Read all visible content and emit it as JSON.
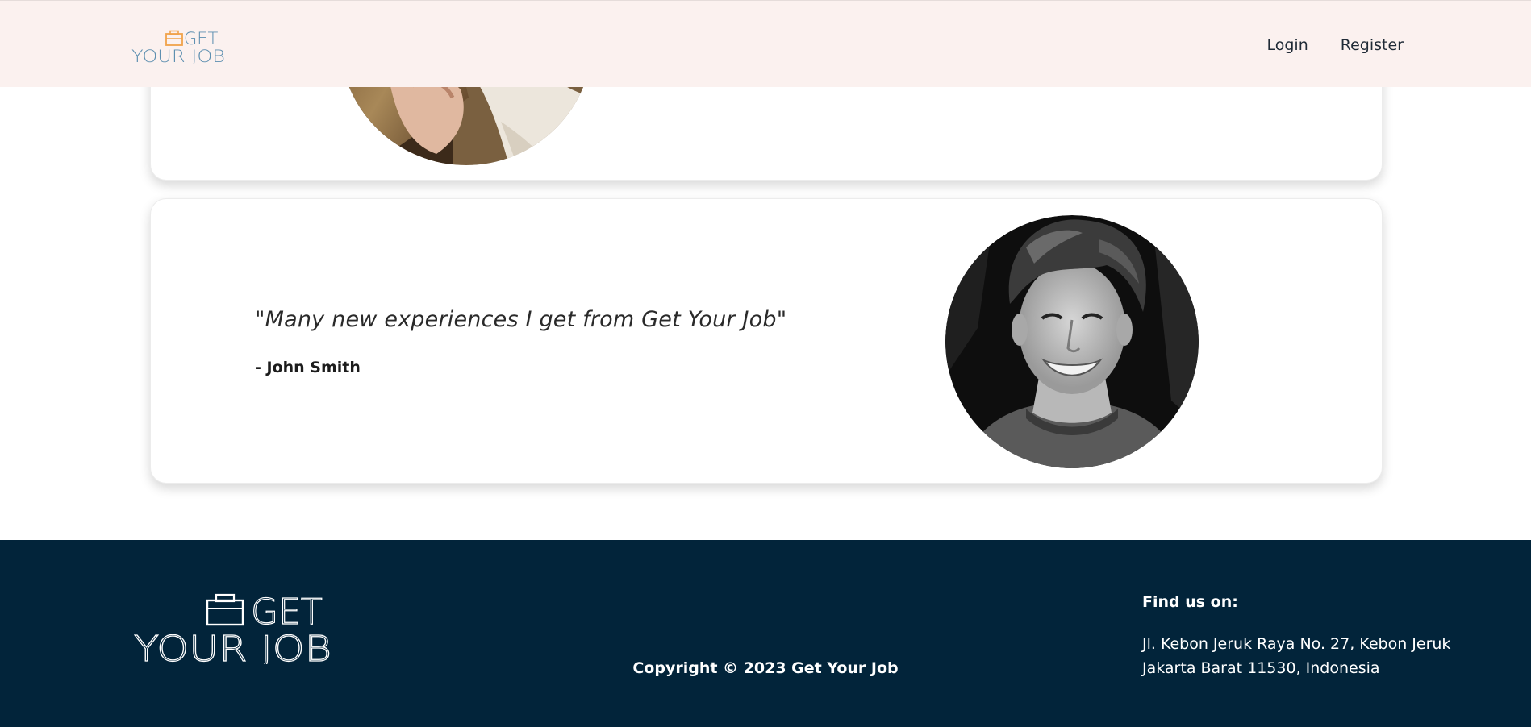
{
  "brand": {
    "logo_top": "GET",
    "logo_bottom": "YOUR JOB",
    "accent_color": "#f0a24a",
    "logo_text_color": "#5d8fb0"
  },
  "nav": {
    "login_label": "Login",
    "register_label": "Register"
  },
  "testimonials": [
    {
      "photo": "woman-portrait-photo"
    },
    {
      "quote": "\"Many new experiences I get from Get Your Job\"",
      "author": "- John Smith",
      "photo": "man-portrait-photo"
    }
  ],
  "footer": {
    "copyright": "Copyright © 2023 Get Your Job",
    "find_us_title": "Find us on:",
    "address_line_1": "Jl. Kebon Jeruk Raya No. 27, Kebon Jeruk",
    "address_line_2": "Jakarta Barat 11530, Indonesia",
    "background_color": "#02243a"
  }
}
